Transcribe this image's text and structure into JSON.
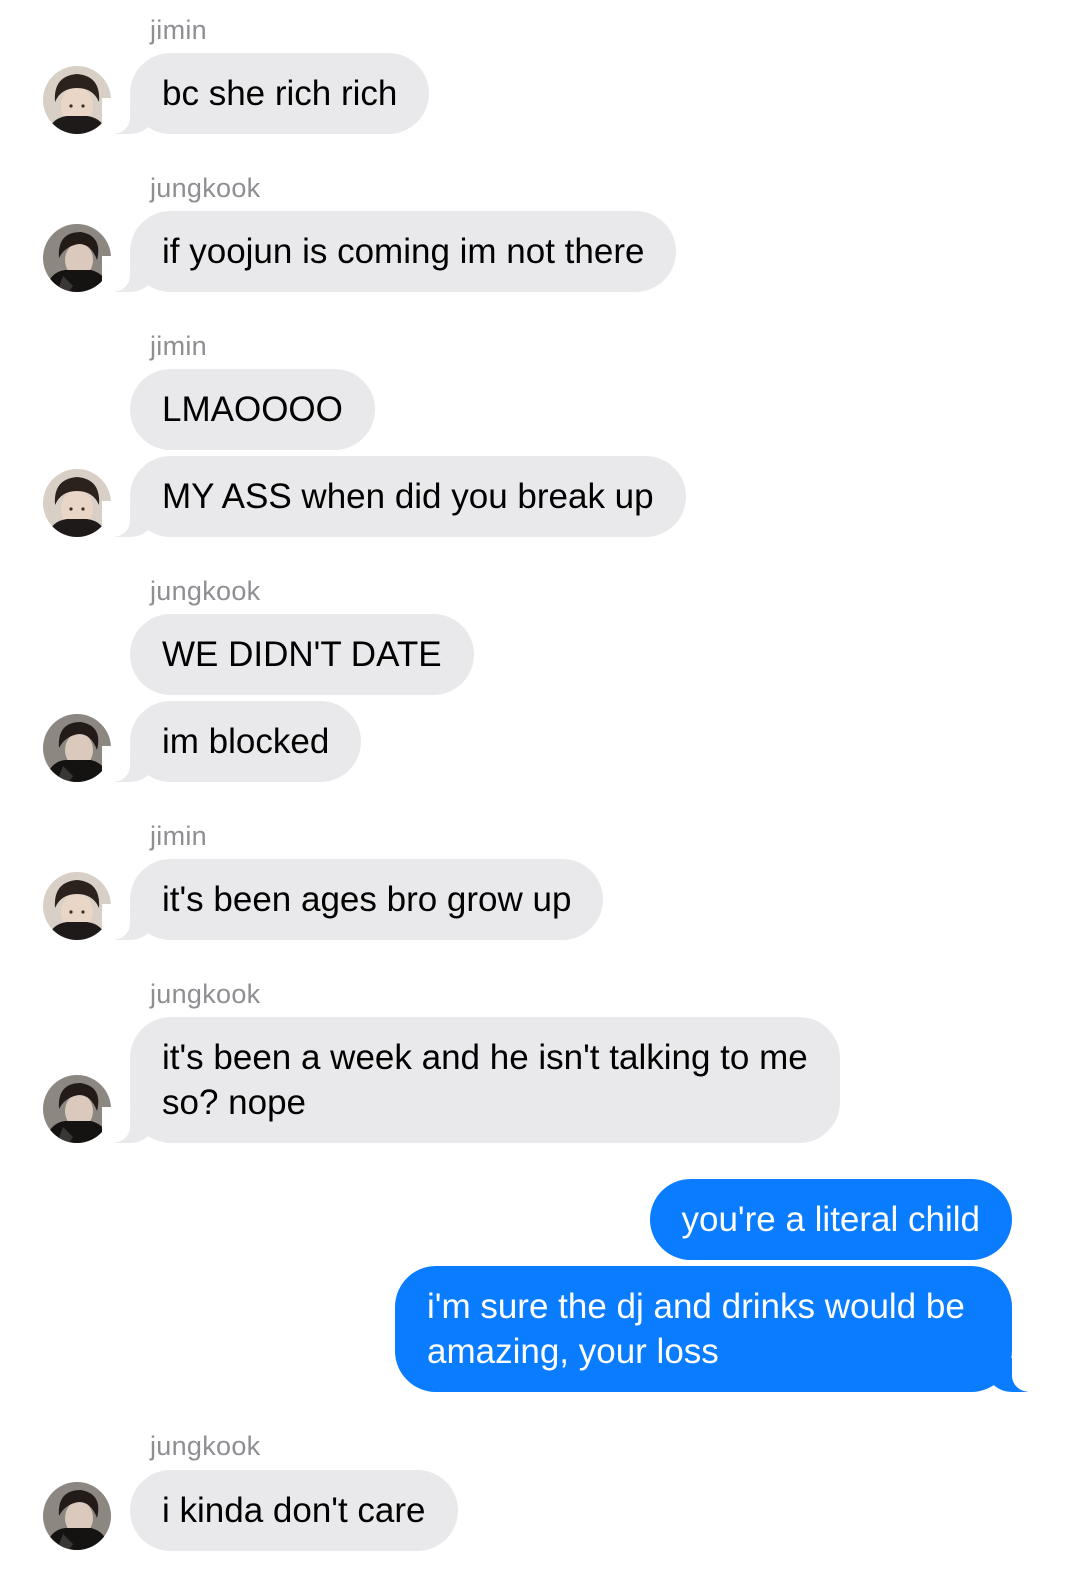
{
  "senders": {
    "jimin": "jimin",
    "jungkook": "jungkook"
  },
  "messages": {
    "m1": "bc she rich rich",
    "m2": "if yoojun is coming im not there",
    "m3": "LMAOOOO",
    "m4": "MY ASS when did you break up",
    "m5": "WE DIDN'T DATE",
    "m6": "im blocked",
    "m7": "it's been ages bro grow up",
    "m8a": "it's been a week and he isn't talking to me",
    "m8b": "so? nope",
    "m9": "you're a literal child",
    "m10a": "i'm sure the dj and drinks would be",
    "m10b": "amazing, your loss",
    "m11": "i kinda don't care"
  },
  "colors": {
    "incoming_bubble": "#e9e9eb",
    "outgoing_bubble": "#0a7cff",
    "sender_label": "#8e8e93"
  }
}
